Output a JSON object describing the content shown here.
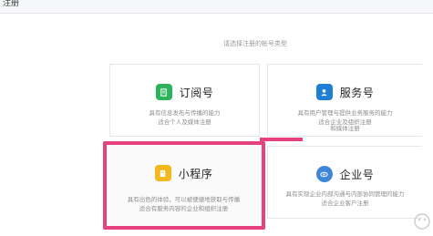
{
  "header": {
    "title": "注册"
  },
  "page": {
    "subtitle": "请选择注册的帐号类型"
  },
  "accounts": [
    {
      "title": "订阅号",
      "icon": "document-icon",
      "icon_color": "#2bb35a",
      "desc": [
        "具有信息发布与传播的能力",
        "适合个人及媒体注册"
      ]
    },
    {
      "title": "服务号",
      "icon": "user-icon",
      "icon_color": "#1f7fd4",
      "desc": [
        "具有用户管理与提供业务服务的能力",
        "适合企业及组织注册",
        "和媒体注册"
      ]
    },
    {
      "title": "小程序",
      "icon": "mini-program-icon",
      "icon_color": "#f5b81c",
      "desc": [
        "具有出色的体验，可以被便捷地获取与传播",
        "适合有服务内容的企业和组织注册"
      ]
    },
    {
      "title": "企业号",
      "icon": "enterprise-icon",
      "icon_color": "#3f86d8",
      "desc": [
        "具有实现企业内部沟通与内部协同管理的能力",
        "适合企业客户注册"
      ]
    }
  ],
  "colors": {
    "highlight": "#e6427f"
  }
}
